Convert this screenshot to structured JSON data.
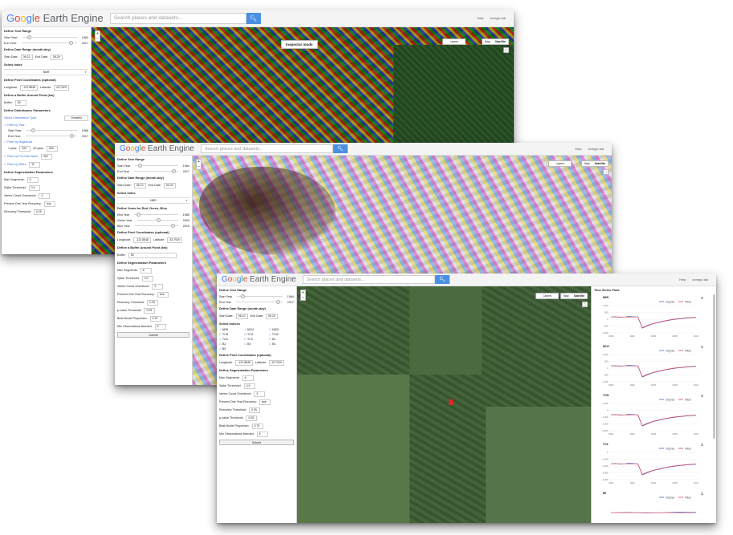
{
  "windows": [
    {
      "logo": {
        "G": "G",
        "o1": "o",
        "o2": "o",
        "g": "g",
        "l": "l",
        "e": "e",
        "rest": " Earth Engine"
      },
      "search_placeholder": "Search places and datasets...",
      "search_icon": "search-icon",
      "help": "Help",
      "user": "ceregio lab",
      "panel": {
        "define_year_range": "Define Year Range",
        "start_year_label": "Start Year:",
        "start_year": "1984",
        "end_year_label": "End Year:",
        "end_year": "2017",
        "date_range": "Define Date Range (month-day)",
        "start_date_label": "Start Date:",
        "start_date": "06-10",
        "end_date_label": "End Date:",
        "end_date": "09-20",
        "select_index": "Select Index",
        "index_value": "NBR",
        "pixel_coords": "Define Pixel Coordinates (optional)",
        "lon_label": "Longitude:",
        "lon": "-122.8848",
        "lat_label": "Latitude:",
        "lat": "43.7929",
        "buffer_title": "Define a Buffer Around Point (km)",
        "buffer_label": "Buffer:",
        "buffer": "50",
        "disturbance_title": "Define Disturbance Parameters",
        "dist_type_label": "Select Disturbance Type:",
        "dist_type": "Greatest",
        "filter_year": "Filter by Year:",
        "dist_start_label": "Start Year:",
        "dist_start": "1986",
        "dist_end_label": "End Year:",
        "dist_end": "2017",
        "filter_mag": "Filter by Magnitude",
        "mag_1yr_label": "1 year:",
        "mag_1yr": "200",
        "mag_20yr_label": "20-year:",
        "mag_20yr": "300",
        "filter_predist": "Filter by Pre-Dist Value:",
        "predist": "400",
        "filter_mmu": "Filter by MMU:",
        "mmu": "11",
        "seg_title": "Define Segmentation Parameters",
        "max_seg_label": "Max Segments:",
        "max_seg": "6",
        "spike_label": "Spike Threshold:",
        "spike": "0.9",
        "vertex_label": "Vertex Count Overshoot:",
        "vertex": "3",
        "prevent_label": "Prevent One Year Recovery:",
        "prevent": "true",
        "recovery_label": "Recovery Threshold:",
        "recovery": "0.25"
      },
      "map": {
        "inspector": "Inspector mode",
        "layers": "Layers",
        "map_label": "Map",
        "satellite_label": "Satellite"
      }
    },
    {
      "logo": {
        "G": "G",
        "o1": "o",
        "o2": "o",
        "g": "g",
        "l": "l",
        "e": "e",
        "rest": " Earth Engine"
      },
      "search_placeholder": "Search places and datasets...",
      "search_icon": "search-icon",
      "help": "Help",
      "user": "ceregio lab",
      "panel": {
        "define_year_range": "Define Year Range",
        "start_year_label": "Start Year",
        "start_year": "1984",
        "end_year_label": "End Year",
        "end_year": "2017",
        "date_range": "Define Date Range (month-day)",
        "start_date_label": "Start Date:",
        "start_date": "06-10",
        "end_date_label": "End Date:",
        "end_date": "09-20",
        "select_index": "Select Index",
        "index_value": "NBR",
        "rgb_title": "Define Years for Red, Green, Blue",
        "red_label": "Red Year",
        "red": "1985",
        "green_label": "Green Year",
        "green": "2000",
        "blue_label": "Blue Year",
        "blue": "2015",
        "pixel_coords": "Define Pixel Coordinates (optional)",
        "lon_label": "Longitude:",
        "lon": "-122.8848",
        "lat_label": "Latitude:",
        "lat": "43.7929",
        "buffer_title": "Define a Buffer Around Point (km)",
        "buffer_label": "Buffer:",
        "buffer": "50",
        "seg_title": "Define Segmentation Parameters",
        "max_seg_label": "Max Segments:",
        "max_seg": "6",
        "spike_label": "Spike Threshold:",
        "spike": "0.9",
        "vertex_label": "Vertex Count Overshoot:",
        "vertex": "3",
        "prevent_label": "Prevent One Year Recovery:",
        "prevent": "true",
        "recovery_label": "Recovery Threshold:",
        "recovery": "0.25",
        "pval_label": "p-value Threshold:",
        "pval": "0.05",
        "bestmodel_label": "Best Model Proportion:",
        "bestmodel": "0.75",
        "minobs_label": "Min Observations Needed:",
        "minobs": "6",
        "submit": "Submit"
      },
      "map": {
        "layers": "Layers",
        "map_label": "Map",
        "satellite_label": "Satellite"
      }
    },
    {
      "logo": {
        "G": "G",
        "o1": "o",
        "o2": "o",
        "g": "g",
        "l": "l",
        "e": "e",
        "rest": " Earth Engine"
      },
      "search_placeholder": "Search places and datasets...",
      "search_icon": "search-icon",
      "help": "Help",
      "user": "ceregio lab",
      "panel": {
        "define_year_range": "Define Year Range",
        "start_year_label": "Start Year",
        "start_year": "1984",
        "end_year_label": "End Year",
        "end_year": "2017",
        "date_range": "Define Date Range (month-day)",
        "start_date_label": "Start Date:",
        "start_date": "06-10",
        "end_date_label": "End Date:",
        "end_date": "09-20",
        "select_indices": "Select Indices",
        "indices": [
          {
            "label": "NBR",
            "checked": true
          },
          {
            "label": "NDVI",
            "checked": true
          },
          {
            "label": "NDSI",
            "checked": false
          },
          {
            "label": "TCB",
            "checked": false
          },
          {
            "label": "TCG",
            "checked": false
          },
          {
            "label": "TCW",
            "checked": true
          },
          {
            "label": "TCA",
            "checked": true
          },
          {
            "label": "TCC",
            "checked": false
          },
          {
            "label": "B1",
            "checked": false
          },
          {
            "label": "B2",
            "checked": false
          },
          {
            "label": "B3",
            "checked": false
          },
          {
            "label": "B4",
            "checked": false
          },
          {
            "label": "B5",
            "checked": true
          }
        ],
        "pixel_coords": "Define Pixel Coordinates (optional)",
        "lon_label": "Longitude:",
        "lon": "-122.8848",
        "lat_label": "Latitude:",
        "lat": "43.7929",
        "seg_title": "Define Segmentation Parameters",
        "max_seg_label": "Max Segments:",
        "max_seg": "6",
        "spike_label": "Spike Threshold:",
        "spike": "0.9",
        "vertex_label": "Vertex Count Overshoot:",
        "vertex": "3",
        "prevent_label": "Prevent One Year Recovery:",
        "prevent": "true",
        "recovery_label": "Recovery Threshold:",
        "recovery": "0.25",
        "pval_label": "p-value Threshold:",
        "pval": "0.05",
        "bestmodel_label": "Best Model Proportion:",
        "bestmodel": "0.75",
        "minobs_label": "Min Observations Needed:",
        "minobs": "6",
        "submit": "Submit"
      },
      "map": {
        "layers": "Layers",
        "map_label": "Map",
        "satellite_label": "Satellite"
      },
      "time_series": {
        "title": "Time Series Plots",
        "legend_original": "Original",
        "legend_fitted": "Fitted",
        "x_ticks": [
          "1984",
          "1992",
          "2000",
          "2008",
          "2016"
        ],
        "plots": [
          {
            "name": "NBR",
            "y_ticks": [
              "1,000",
              "500",
              "0",
              "-500",
              "-1,000"
            ],
            "ylim": [
              -1000,
              1000
            ]
          },
          {
            "name": "NDVI",
            "y_ticks": [
              "1,000",
              "500",
              "0",
              "-500",
              "-1,000"
            ],
            "ylim": [
              -1000,
              1000
            ]
          },
          {
            "name": "TCW",
            "y_ticks": [
              "1,000",
              "0",
              "-1,000",
              "-2,000",
              "-3,000"
            ],
            "ylim": [
              -3000,
              1000
            ]
          },
          {
            "name": "TCA",
            "y_ticks": [
              "0",
              "-1,000",
              "-2,000",
              "-3,000",
              "-4,000"
            ],
            "ylim": [
              -4000,
              0
            ]
          },
          {
            "name": "B5",
            "y_ticks": [],
            "ylim": [
              0,
              1
            ]
          }
        ]
      }
    }
  ],
  "colors": {
    "link_blue": "#3a6fd8",
    "search_button": "#4a90e2",
    "original_series": "#3b6fd8",
    "fitted_series": "#e0405a"
  }
}
